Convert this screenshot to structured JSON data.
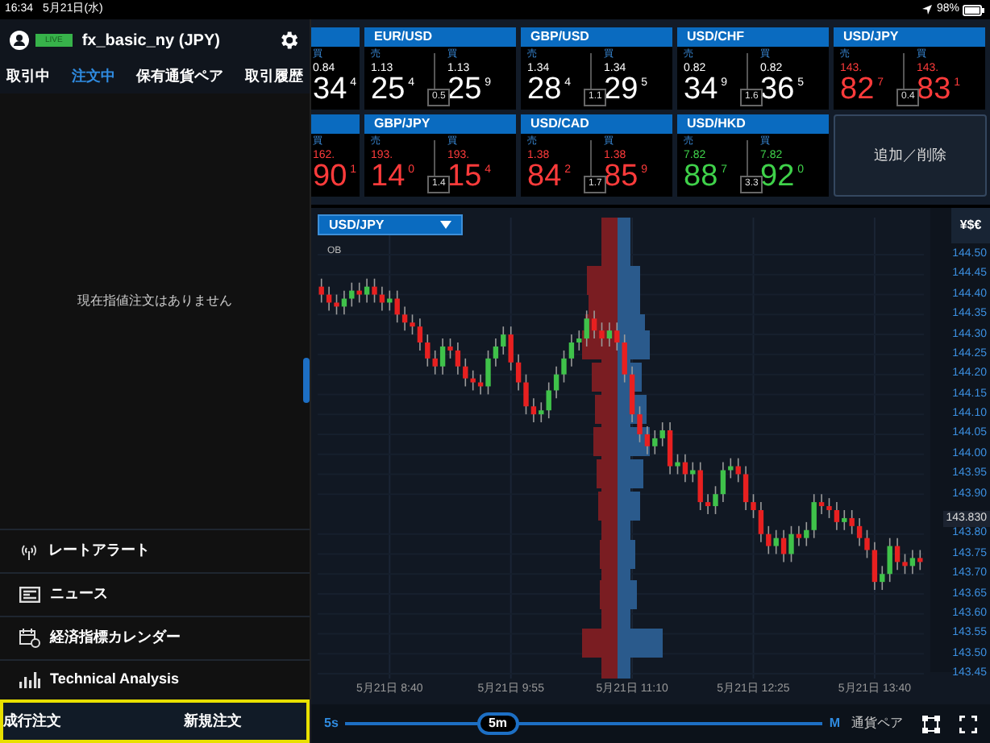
{
  "status_bar": {
    "time": "16:34",
    "date": "5月21日(水)",
    "battery": "98%"
  },
  "account": {
    "badge": "LIVE",
    "name": "fx_basic_ny (JPY)"
  },
  "tabs": [
    {
      "label": "取引中",
      "selected": false
    },
    {
      "label": "注文中",
      "selected": true
    },
    {
      "label": "保有通貨ペア",
      "selected": false
    },
    {
      "label": "取引履歴",
      "selected": false
    }
  ],
  "empty_message": "現在指値注文はありません",
  "menu": [
    {
      "kind": "alert",
      "label": "レートアラート"
    },
    {
      "kind": "news",
      "label": "ニュース"
    },
    {
      "kind": "calendar",
      "label": "経済指標カレンダー"
    },
    {
      "kind": "analysis",
      "label": "Technical Analysis"
    }
  ],
  "order_bar": [
    "成行注文",
    "新規注文"
  ],
  "rate_rows": [
    [
      {
        "partial": true,
        "color": "#ffffff",
        "buy": {
          "label": "買",
          "prefix": "0.84",
          "pips": "34",
          "frac": "4"
        }
      },
      {
        "partial": false,
        "pair": "EUR/USD",
        "color": "#ffffff",
        "sell": {
          "label": "売",
          "prefix": "1.13",
          "pips": "25",
          "frac": "4"
        },
        "buy": {
          "label": "買",
          "prefix": "1.13",
          "pips": "25",
          "frac": "9"
        },
        "spread": "0.5"
      },
      {
        "partial": false,
        "pair": "GBP/USD",
        "color": "#ffffff",
        "sell": {
          "label": "売",
          "prefix": "1.34",
          "pips": "28",
          "frac": "4"
        },
        "buy": {
          "label": "買",
          "prefix": "1.34",
          "pips": "29",
          "frac": "5"
        },
        "spread": "1.1"
      },
      {
        "partial": false,
        "pair": "USD/CHF",
        "color": "#ffffff",
        "sell": {
          "label": "売",
          "prefix": "0.82",
          "pips": "34",
          "frac": "9"
        },
        "buy": {
          "label": "買",
          "prefix": "0.82",
          "pips": "36",
          "frac": "5"
        },
        "spread": "1.6"
      },
      {
        "partial": false,
        "pair": "USD/JPY",
        "color": "#ff3b3b",
        "sell": {
          "label": "売",
          "prefix": "143.",
          "pips": "82",
          "frac": "7"
        },
        "buy": {
          "label": "買",
          "prefix": "143.",
          "pips": "83",
          "frac": "1"
        },
        "spread": "0.4"
      }
    ],
    [
      {
        "partial": true,
        "color": "#ff3b3b",
        "buy": {
          "label": "買",
          "prefix": "162.",
          "pips": "90",
          "frac": "1"
        }
      },
      {
        "partial": false,
        "pair": "GBP/JPY",
        "color": "#ff3b3b",
        "sell": {
          "label": "売",
          "prefix": "193.",
          "pips": "14",
          "frac": "0"
        },
        "buy": {
          "label": "買",
          "prefix": "193.",
          "pips": "15",
          "frac": "4"
        },
        "spread": "1.4"
      },
      {
        "partial": false,
        "pair": "USD/CAD",
        "color": "#ff3b3b",
        "sell": {
          "label": "売",
          "prefix": "1.38",
          "pips": "84",
          "frac": "2"
        },
        "buy": {
          "label": "買",
          "prefix": "1.38",
          "pips": "85",
          "frac": "9"
        },
        "spread": "1.7"
      },
      {
        "partial": false,
        "pair": "USD/HKD",
        "color": "#3fd14a",
        "sell": {
          "label": "売",
          "prefix": "7.82",
          "pips": "88",
          "frac": "7"
        },
        "buy": {
          "label": "買",
          "prefix": "7.82",
          "pips": "92",
          "frac": "0"
        },
        "spread": "3.3"
      }
    ]
  ],
  "add_remove_button": "追加／削除",
  "chart": {
    "pair_select": "USD/JPY",
    "ob_label": "OB",
    "currency_button": "¥$€",
    "price_tag": "143.830",
    "chart_data": {
      "type": "candlestick",
      "categories": [
        null,
        null,
        null,
        null,
        null,
        null,
        null,
        null,
        null,
        "5月21日 8:40",
        null,
        null,
        null,
        null,
        null,
        null,
        null,
        null,
        null,
        null,
        null,
        null,
        null,
        null,
        null,
        "5月21日 9:55",
        null,
        null,
        null,
        null,
        null,
        null,
        null,
        null,
        null,
        null,
        null,
        null,
        null,
        null,
        null,
        "5月21日 11:10",
        null,
        null,
        null,
        null,
        null,
        null,
        null,
        null,
        null,
        null,
        null,
        null,
        null,
        null,
        null,
        "5月21日 12:25",
        null,
        null,
        null,
        null,
        null,
        null,
        null,
        null,
        null,
        null,
        null,
        null,
        null,
        null,
        null,
        "5月21日 13:40",
        null,
        null,
        null,
        null,
        null,
        null
      ],
      "ohlc": [
        [
          144.42,
          144.44,
          144.38,
          144.4
        ],
        [
          144.4,
          144.42,
          144.36,
          144.38
        ],
        [
          144.38,
          144.4,
          144.35,
          144.37
        ],
        [
          144.37,
          144.41,
          144.35,
          144.39
        ],
        [
          144.39,
          144.43,
          144.37,
          144.41
        ],
        [
          144.41,
          144.43,
          144.38,
          144.4
        ],
        [
          144.4,
          144.44,
          144.38,
          144.42
        ],
        [
          144.42,
          144.44,
          144.38,
          144.4
        ],
        [
          144.4,
          144.42,
          144.36,
          144.38
        ],
        [
          144.38,
          144.41,
          144.36,
          144.39
        ],
        [
          144.39,
          144.41,
          144.33,
          144.35
        ],
        [
          144.35,
          144.37,
          144.31,
          144.33
        ],
        [
          144.33,
          144.35,
          144.3,
          144.32
        ],
        [
          144.32,
          144.34,
          144.26,
          144.28
        ],
        [
          144.28,
          144.3,
          144.22,
          144.24
        ],
        [
          144.24,
          144.26,
          144.2,
          144.22
        ],
        [
          144.22,
          144.29,
          144.2,
          144.27
        ],
        [
          144.27,
          144.29,
          144.24,
          144.26
        ],
        [
          144.26,
          144.28,
          144.2,
          144.22
        ],
        [
          144.22,
          144.24,
          144.17,
          144.19
        ],
        [
          144.19,
          144.21,
          144.16,
          144.18
        ],
        [
          144.18,
          144.2,
          144.15,
          144.17
        ],
        [
          144.17,
          144.26,
          144.15,
          144.24
        ],
        [
          144.24,
          144.29,
          144.22,
          144.27
        ],
        [
          144.27,
          144.32,
          144.25,
          144.3
        ],
        [
          144.3,
          144.32,
          144.21,
          144.23
        ],
        [
          144.23,
          144.25,
          144.16,
          144.18
        ],
        [
          144.18,
          144.2,
          144.1,
          144.12
        ],
        [
          144.12,
          144.14,
          144.08,
          144.1
        ],
        [
          144.1,
          144.13,
          144.08,
          144.11
        ],
        [
          144.11,
          144.18,
          144.09,
          144.16
        ],
        [
          144.16,
          144.22,
          144.14,
          144.2
        ],
        [
          144.2,
          144.26,
          144.18,
          144.24
        ],
        [
          144.24,
          144.3,
          144.22,
          144.28
        ],
        [
          144.28,
          144.31,
          144.26,
          144.29
        ],
        [
          144.29,
          144.36,
          144.27,
          144.34
        ],
        [
          144.34,
          144.36,
          144.29,
          144.31
        ],
        [
          144.31,
          144.33,
          144.27,
          144.29
        ],
        [
          144.29,
          144.33,
          144.27,
          144.31
        ],
        [
          144.31,
          144.33,
          144.26,
          144.28
        ],
        [
          144.28,
          144.3,
          144.18,
          144.2
        ],
        [
          144.2,
          144.22,
          144.08,
          144.1
        ],
        [
          144.1,
          144.12,
          144.03,
          144.05
        ],
        [
          144.05,
          144.07,
          144.0,
          144.02
        ],
        [
          144.02,
          144.06,
          144.0,
          144.04
        ],
        [
          144.04,
          144.08,
          144.02,
          144.06
        ],
        [
          144.06,
          144.08,
          143.95,
          143.97
        ],
        [
          143.97,
          144.0,
          143.95,
          143.98
        ],
        [
          143.98,
          144.0,
          143.93,
          143.95
        ],
        [
          143.95,
          143.98,
          143.93,
          143.96
        ],
        [
          143.96,
          143.98,
          143.86,
          143.88
        ],
        [
          143.88,
          143.9,
          143.85,
          143.87
        ],
        [
          143.87,
          143.92,
          143.85,
          143.9
        ],
        [
          143.9,
          143.98,
          143.88,
          143.96
        ],
        [
          143.96,
          143.99,
          143.94,
          143.97
        ],
        [
          143.97,
          143.99,
          143.93,
          143.95
        ],
        [
          143.95,
          143.97,
          143.86,
          143.88
        ],
        [
          143.88,
          143.9,
          143.84,
          143.86
        ],
        [
          143.86,
          143.88,
          143.78,
          143.8
        ],
        [
          143.8,
          143.82,
          143.75,
          143.77
        ],
        [
          143.77,
          143.81,
          143.75,
          143.79
        ],
        [
          143.79,
          143.81,
          143.73,
          143.75
        ],
        [
          143.75,
          143.82,
          143.73,
          143.8
        ],
        [
          143.8,
          143.82,
          143.77,
          143.79
        ],
        [
          143.79,
          143.83,
          143.77,
          143.81
        ],
        [
          143.81,
          143.9,
          143.79,
          143.88
        ],
        [
          143.88,
          143.9,
          143.85,
          143.87
        ],
        [
          143.87,
          143.89,
          143.84,
          143.86
        ],
        [
          143.86,
          143.88,
          143.81,
          143.83
        ],
        [
          143.83,
          143.86,
          143.81,
          143.84
        ],
        [
          143.84,
          143.86,
          143.8,
          143.82
        ],
        [
          143.82,
          143.84,
          143.77,
          143.79
        ],
        [
          143.79,
          143.81,
          143.74,
          143.76
        ],
        [
          143.76,
          143.78,
          143.66,
          143.68
        ],
        [
          143.68,
          143.72,
          143.66,
          143.7
        ],
        [
          143.7,
          143.79,
          143.68,
          143.77
        ],
        [
          143.77,
          143.79,
          143.71,
          143.73
        ],
        [
          143.73,
          143.75,
          143.7,
          143.72
        ],
        [
          143.72,
          143.76,
          143.7,
          143.74
        ],
        [
          143.74,
          143.76,
          143.71,
          143.73
        ]
      ],
      "ylim": [
        143.438,
        144.593
      ],
      "grid": true,
      "yticks": [
        {
          "value": 144.5,
          "label": "144.50"
        },
        {
          "value": 144.45,
          "label": "144.45"
        },
        {
          "value": 144.4,
          "label": "144.40"
        },
        {
          "value": 144.35,
          "label": "144.35"
        },
        {
          "value": 144.3,
          "label": "144.30"
        },
        {
          "value": 144.25,
          "label": "144.25"
        },
        {
          "value": 144.2,
          "label": "144.20"
        },
        {
          "value": 144.15,
          "label": "144.15"
        },
        {
          "value": 144.1,
          "label": "144.10"
        },
        {
          "value": 144.05,
          "label": "144.05"
        },
        {
          "value": 144.0,
          "label": "144.00"
        },
        {
          "value": 143.95,
          "label": "143.95"
        },
        {
          "value": 143.9,
          "label": "143.90"
        },
        {
          "value": 143.8,
          "label": "143.80"
        },
        {
          "value": 143.75,
          "label": "143.75"
        },
        {
          "value": 143.7,
          "label": "143.70"
        },
        {
          "value": 143.65,
          "label": "143.65"
        },
        {
          "value": 143.6,
          "label": "143.60"
        },
        {
          "value": 143.55,
          "label": "143.55"
        },
        {
          "value": 143.5,
          "label": "143.50"
        },
        {
          "value": 143.45,
          "label": "143.45"
        }
      ]
    }
  },
  "timeframe": {
    "min_label": "5s",
    "thumb": "5m",
    "max_label": "M",
    "level": 0.32,
    "pairs_button": "通貨ペア"
  }
}
